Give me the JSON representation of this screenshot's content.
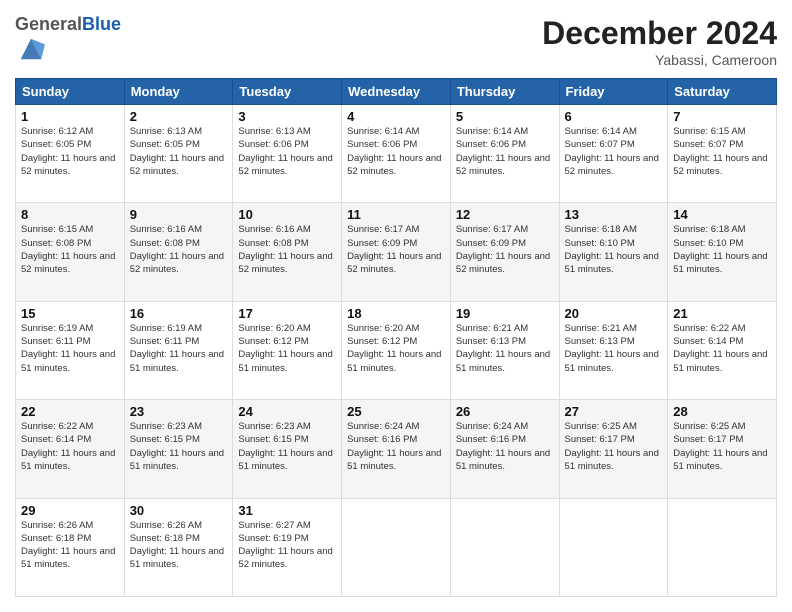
{
  "logo": {
    "general": "General",
    "blue": "Blue"
  },
  "header": {
    "month_year": "December 2024",
    "location": "Yabassi, Cameroon"
  },
  "weekdays": [
    "Sunday",
    "Monday",
    "Tuesday",
    "Wednesday",
    "Thursday",
    "Friday",
    "Saturday"
  ],
  "weeks": [
    [
      {
        "day": "1",
        "sunrise": "6:12 AM",
        "sunset": "6:05 PM",
        "daylight": "11 hours and 52 minutes."
      },
      {
        "day": "2",
        "sunrise": "6:13 AM",
        "sunset": "6:05 PM",
        "daylight": "11 hours and 52 minutes."
      },
      {
        "day": "3",
        "sunrise": "6:13 AM",
        "sunset": "6:06 PM",
        "daylight": "11 hours and 52 minutes."
      },
      {
        "day": "4",
        "sunrise": "6:14 AM",
        "sunset": "6:06 PM",
        "daylight": "11 hours and 52 minutes."
      },
      {
        "day": "5",
        "sunrise": "6:14 AM",
        "sunset": "6:06 PM",
        "daylight": "11 hours and 52 minutes."
      },
      {
        "day": "6",
        "sunrise": "6:14 AM",
        "sunset": "6:07 PM",
        "daylight": "11 hours and 52 minutes."
      },
      {
        "day": "7",
        "sunrise": "6:15 AM",
        "sunset": "6:07 PM",
        "daylight": "11 hours and 52 minutes."
      }
    ],
    [
      {
        "day": "8",
        "sunrise": "6:15 AM",
        "sunset": "6:08 PM",
        "daylight": "11 hours and 52 minutes."
      },
      {
        "day": "9",
        "sunrise": "6:16 AM",
        "sunset": "6:08 PM",
        "daylight": "11 hours and 52 minutes."
      },
      {
        "day": "10",
        "sunrise": "6:16 AM",
        "sunset": "6:08 PM",
        "daylight": "11 hours and 52 minutes."
      },
      {
        "day": "11",
        "sunrise": "6:17 AM",
        "sunset": "6:09 PM",
        "daylight": "11 hours and 52 minutes."
      },
      {
        "day": "12",
        "sunrise": "6:17 AM",
        "sunset": "6:09 PM",
        "daylight": "11 hours and 52 minutes."
      },
      {
        "day": "13",
        "sunrise": "6:18 AM",
        "sunset": "6:10 PM",
        "daylight": "11 hours and 51 minutes."
      },
      {
        "day": "14",
        "sunrise": "6:18 AM",
        "sunset": "6:10 PM",
        "daylight": "11 hours and 51 minutes."
      }
    ],
    [
      {
        "day": "15",
        "sunrise": "6:19 AM",
        "sunset": "6:11 PM",
        "daylight": "11 hours and 51 minutes."
      },
      {
        "day": "16",
        "sunrise": "6:19 AM",
        "sunset": "6:11 PM",
        "daylight": "11 hours and 51 minutes."
      },
      {
        "day": "17",
        "sunrise": "6:20 AM",
        "sunset": "6:12 PM",
        "daylight": "11 hours and 51 minutes."
      },
      {
        "day": "18",
        "sunrise": "6:20 AM",
        "sunset": "6:12 PM",
        "daylight": "11 hours and 51 minutes."
      },
      {
        "day": "19",
        "sunrise": "6:21 AM",
        "sunset": "6:13 PM",
        "daylight": "11 hours and 51 minutes."
      },
      {
        "day": "20",
        "sunrise": "6:21 AM",
        "sunset": "6:13 PM",
        "daylight": "11 hours and 51 minutes."
      },
      {
        "day": "21",
        "sunrise": "6:22 AM",
        "sunset": "6:14 PM",
        "daylight": "11 hours and 51 minutes."
      }
    ],
    [
      {
        "day": "22",
        "sunrise": "6:22 AM",
        "sunset": "6:14 PM",
        "daylight": "11 hours and 51 minutes."
      },
      {
        "day": "23",
        "sunrise": "6:23 AM",
        "sunset": "6:15 PM",
        "daylight": "11 hours and 51 minutes."
      },
      {
        "day": "24",
        "sunrise": "6:23 AM",
        "sunset": "6:15 PM",
        "daylight": "11 hours and 51 minutes."
      },
      {
        "day": "25",
        "sunrise": "6:24 AM",
        "sunset": "6:16 PM",
        "daylight": "11 hours and 51 minutes."
      },
      {
        "day": "26",
        "sunrise": "6:24 AM",
        "sunset": "6:16 PM",
        "daylight": "11 hours and 51 minutes."
      },
      {
        "day": "27",
        "sunrise": "6:25 AM",
        "sunset": "6:17 PM",
        "daylight": "11 hours and 51 minutes."
      },
      {
        "day": "28",
        "sunrise": "6:25 AM",
        "sunset": "6:17 PM",
        "daylight": "11 hours and 51 minutes."
      }
    ],
    [
      {
        "day": "29",
        "sunrise": "6:26 AM",
        "sunset": "6:18 PM",
        "daylight": "11 hours and 51 minutes."
      },
      {
        "day": "30",
        "sunrise": "6:26 AM",
        "sunset": "6:18 PM",
        "daylight": "11 hours and 51 minutes."
      },
      {
        "day": "31",
        "sunrise": "6:27 AM",
        "sunset": "6:19 PM",
        "daylight": "11 hours and 52 minutes."
      },
      null,
      null,
      null,
      null
    ]
  ]
}
